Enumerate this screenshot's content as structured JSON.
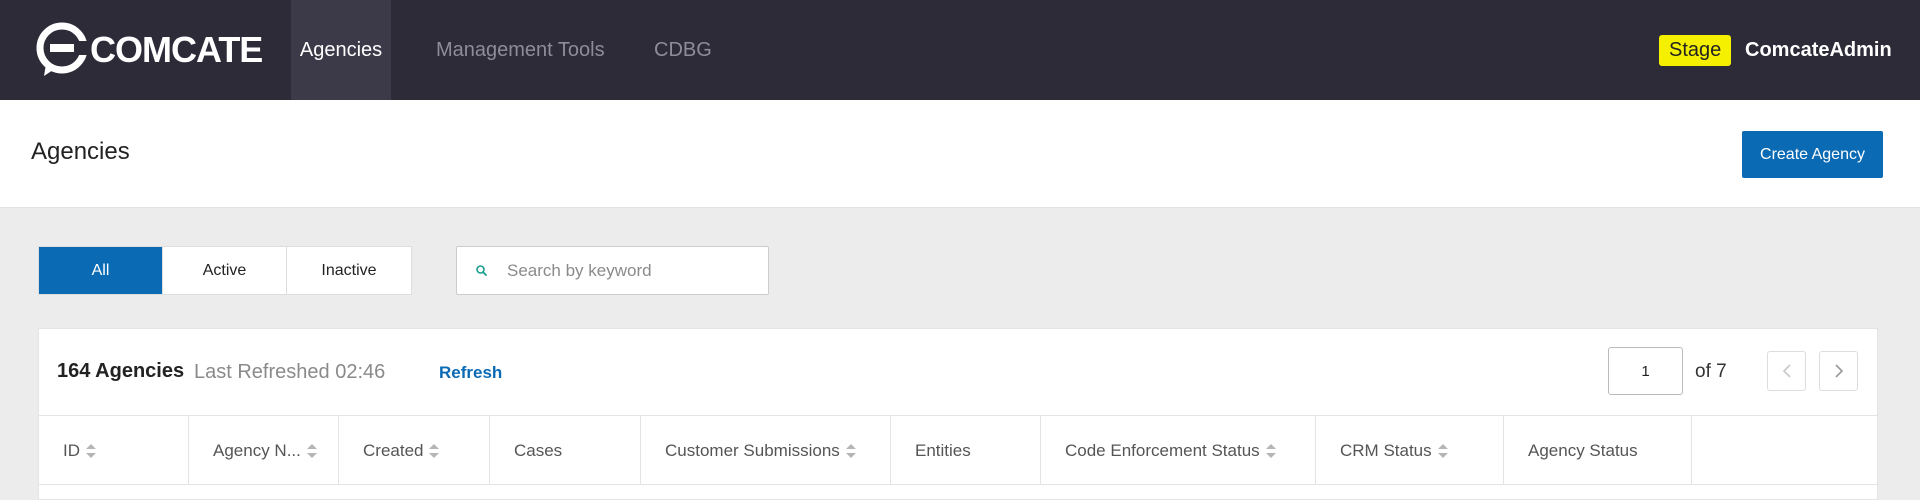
{
  "brand": {
    "name": "COMCATE",
    "logo_icon": "comcate-logo-icon"
  },
  "nav": [
    {
      "label": "Agencies",
      "active": true
    },
    {
      "label": "Management Tools",
      "active": false
    },
    {
      "label": "CDBG",
      "active": false
    }
  ],
  "environment": {
    "label": "Stage",
    "color": "#f5f000"
  },
  "user": {
    "name": "ComcateAdmin"
  },
  "header": {
    "title": "Agencies",
    "create_label": "Create Agency"
  },
  "filters": {
    "segments": [
      {
        "label": "All",
        "active": true
      },
      {
        "label": "Active",
        "active": false
      },
      {
        "label": "Inactive",
        "active": false
      }
    ],
    "search": {
      "placeholder": "Search by keyword",
      "value": "",
      "icon": "search-icon"
    }
  },
  "table": {
    "count_label": "164 Agencies",
    "last_refreshed": "Last Refreshed 02:46",
    "refresh_label": "Refresh",
    "page": {
      "current": "1",
      "of_label": "of 7"
    },
    "columns": [
      {
        "label": "ID",
        "sortable": true
      },
      {
        "label": "Agency N...",
        "sortable": true
      },
      {
        "label": "Created",
        "sortable": true
      },
      {
        "label": "Cases",
        "sortable": false
      },
      {
        "label": "Customer Submissions",
        "sortable": true
      },
      {
        "label": "Entities",
        "sortable": false
      },
      {
        "label": "Code Enforcement Status",
        "sortable": true
      },
      {
        "label": "CRM Status",
        "sortable": true
      },
      {
        "label": "Agency Status",
        "sortable": false
      },
      {
        "label": "",
        "sortable": false
      }
    ]
  },
  "colors": {
    "accent": "#0a6ab4",
    "topbar": "#2d2b38",
    "stage": "#f5f000"
  }
}
